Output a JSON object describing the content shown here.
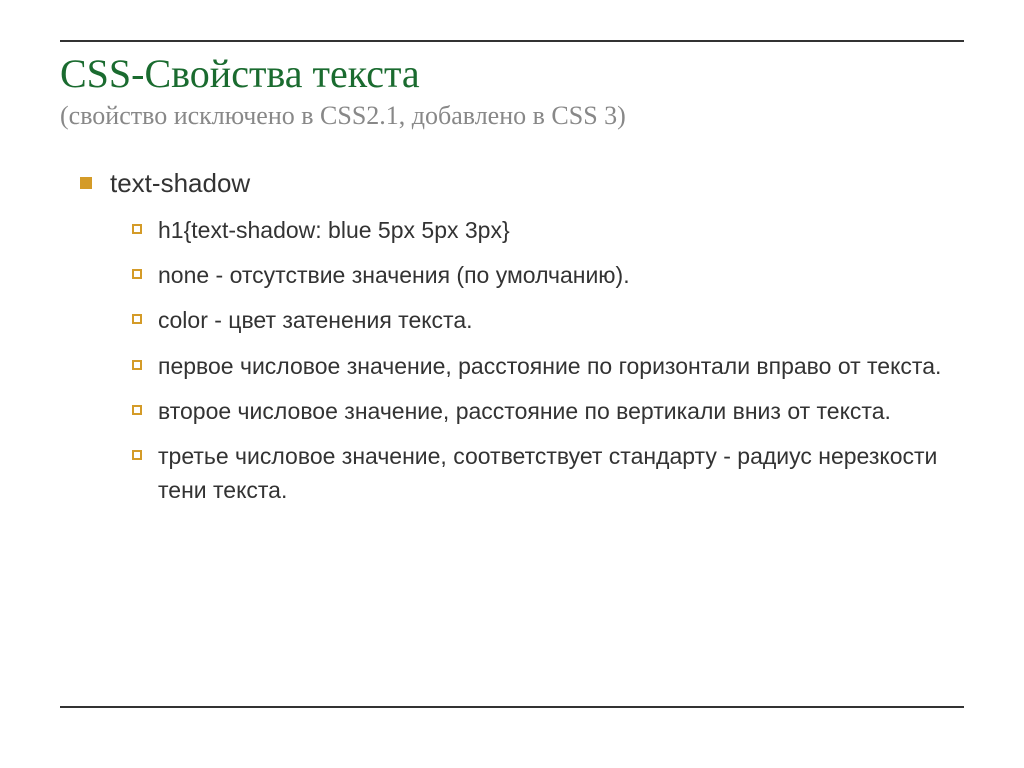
{
  "title": "CSS-Свойства текста",
  "subtitle": "(свойство исключено в CSS2.1, добавлено в CSS 3)",
  "main": {
    "item": "text-shadow",
    "subitems": [
      "h1{text-shadow: blue 5px 5px 3px}",
      "none - отсутствие значения (по умолчанию).",
      "color - цвет затенения текста.",
      "первое числовое значение, расстояние по горизонтали вправо от текста.",
      "второе числовое значение, расстояние по вертикали вниз от текста.",
      "третье числовое значение, соответствует стандарту - радиус нерезкости тени текста."
    ]
  }
}
